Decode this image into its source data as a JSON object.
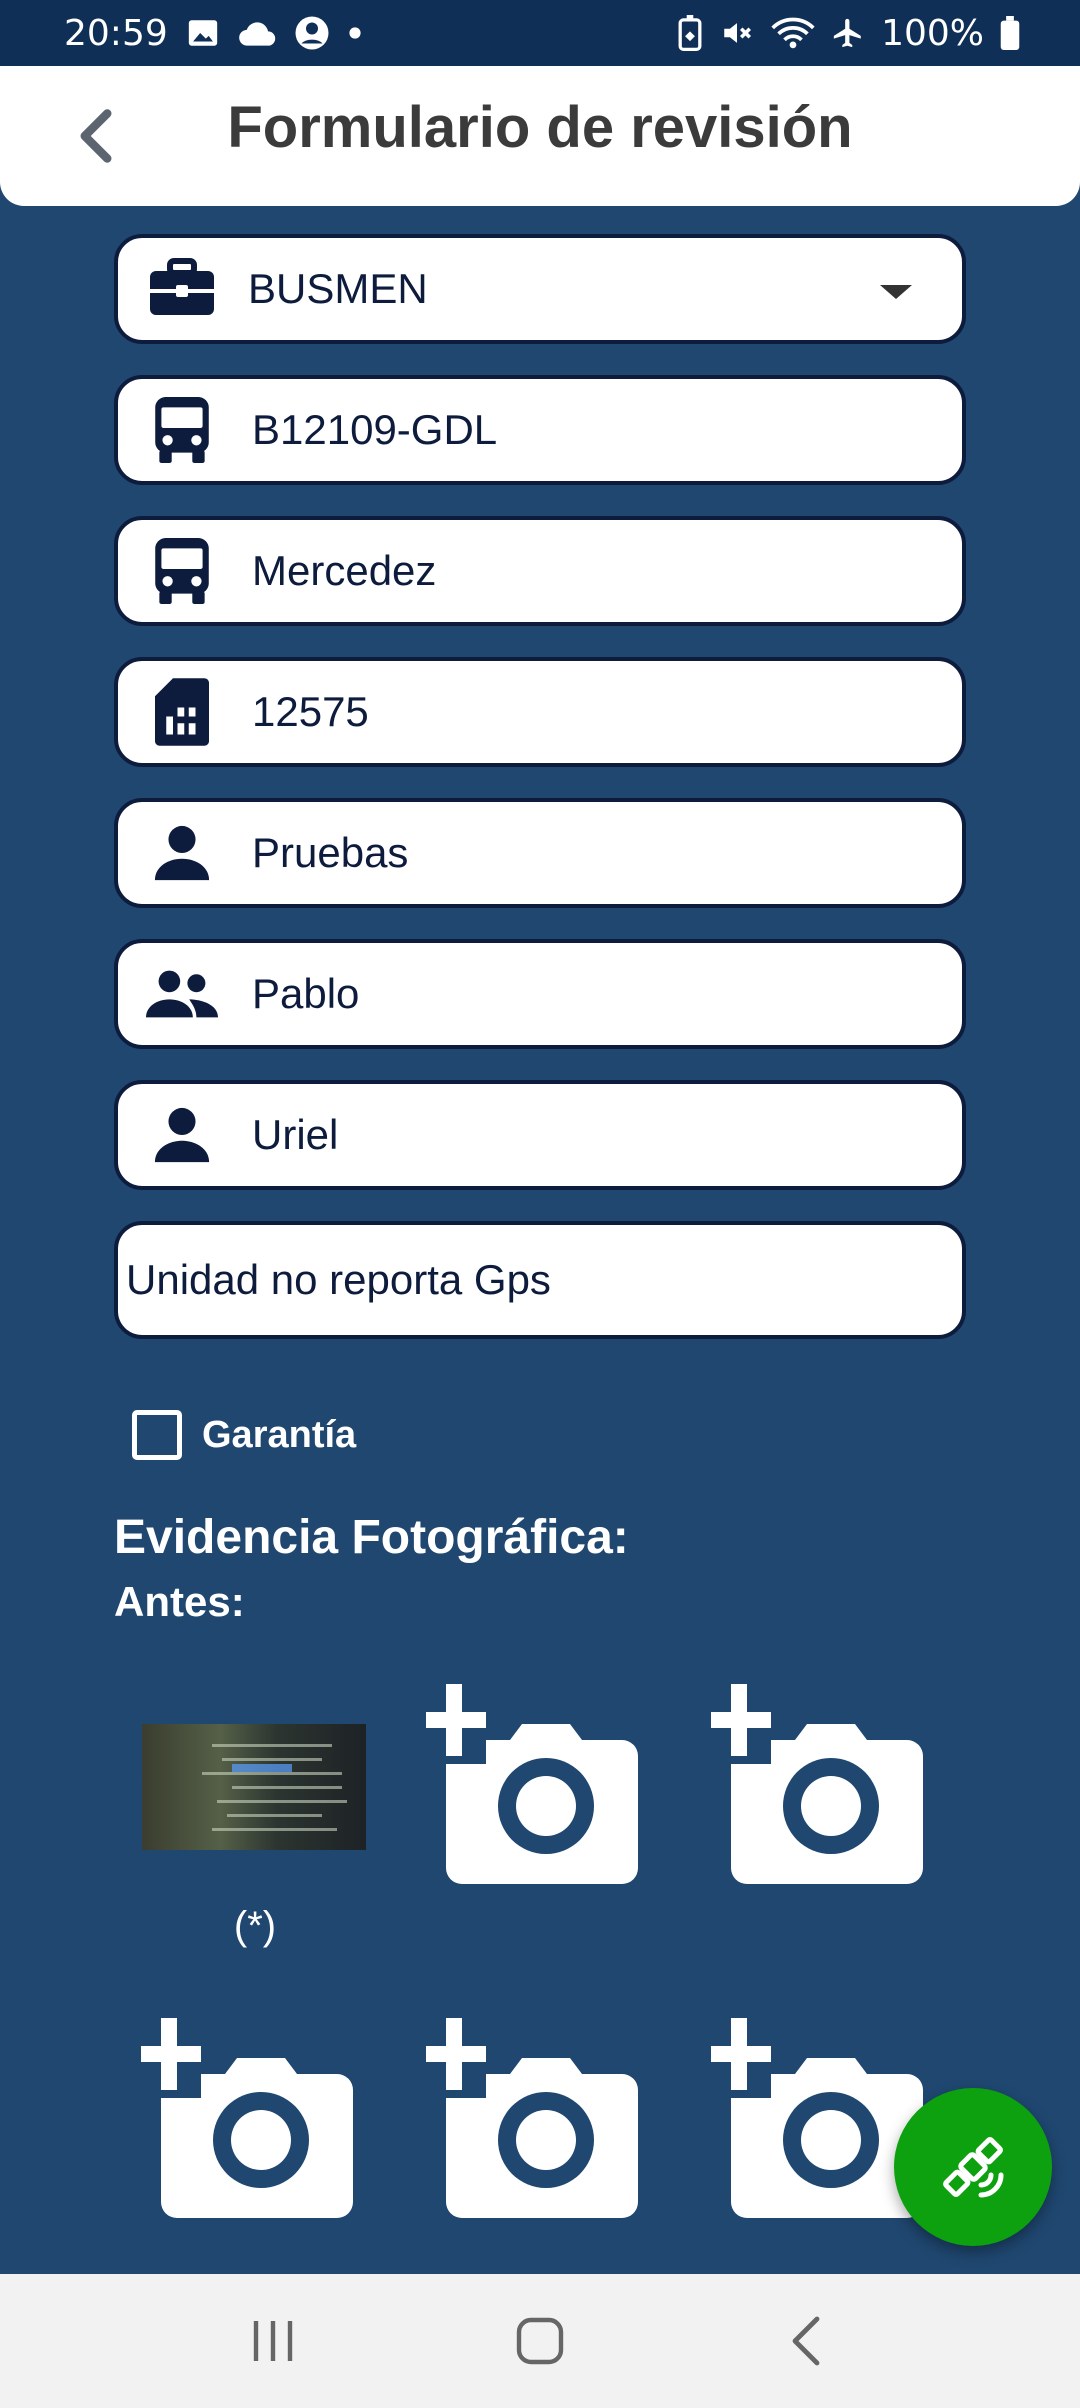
{
  "status_bar": {
    "time": "20:59",
    "battery": "100%",
    "left_icons": [
      "image-icon",
      "cloud-icon",
      "account-circle-icon",
      "dot-icon"
    ],
    "right_icons": [
      "battery-saver-icon",
      "mute-icon",
      "wifi-icon",
      "airplane-icon",
      "battery-icon"
    ]
  },
  "header": {
    "title": "Formulario de revisión",
    "back_icon": "chevron-left-icon"
  },
  "fields": [
    {
      "icon": "briefcase-icon",
      "value": "BUSMEN",
      "dropdown": true
    },
    {
      "icon": "bus-icon",
      "value": "B12109-GDL"
    },
    {
      "icon": "bus-icon",
      "value": "Mercedez"
    },
    {
      "icon": "sim-card-icon",
      "value": "12575"
    },
    {
      "icon": "person-icon",
      "value": "Pruebas"
    },
    {
      "icon": "group-icon",
      "value": "Pablo"
    },
    {
      "icon": "person-icon",
      "value": "Uriel"
    },
    {
      "icon": "",
      "value": "Unidad no reporta Gps"
    }
  ],
  "warranty": {
    "label": "Garantía",
    "checked": false
  },
  "evidence": {
    "title": "Evidencia Fotográfica:",
    "subtitle": "Antes:",
    "required_mark": "(*)",
    "slots": [
      {
        "filled": true
      },
      {
        "filled": false,
        "icon": "add-photo-icon"
      },
      {
        "filled": false,
        "icon": "add-photo-icon"
      },
      {
        "filled": false,
        "icon": "add-photo-icon"
      },
      {
        "filled": false,
        "icon": "add-photo-icon"
      },
      {
        "filled": false,
        "icon": "add-photo-icon"
      }
    ]
  },
  "fab": {
    "icon": "satellite-icon",
    "color": "#0ea10f"
  },
  "nav_bar": {
    "buttons": [
      "recent-apps-icon",
      "home-icon",
      "back-icon"
    ]
  },
  "colors": {
    "background": "#1f4770",
    "status_bar": "#0f2f57",
    "field_border": "#0d1b3d"
  }
}
